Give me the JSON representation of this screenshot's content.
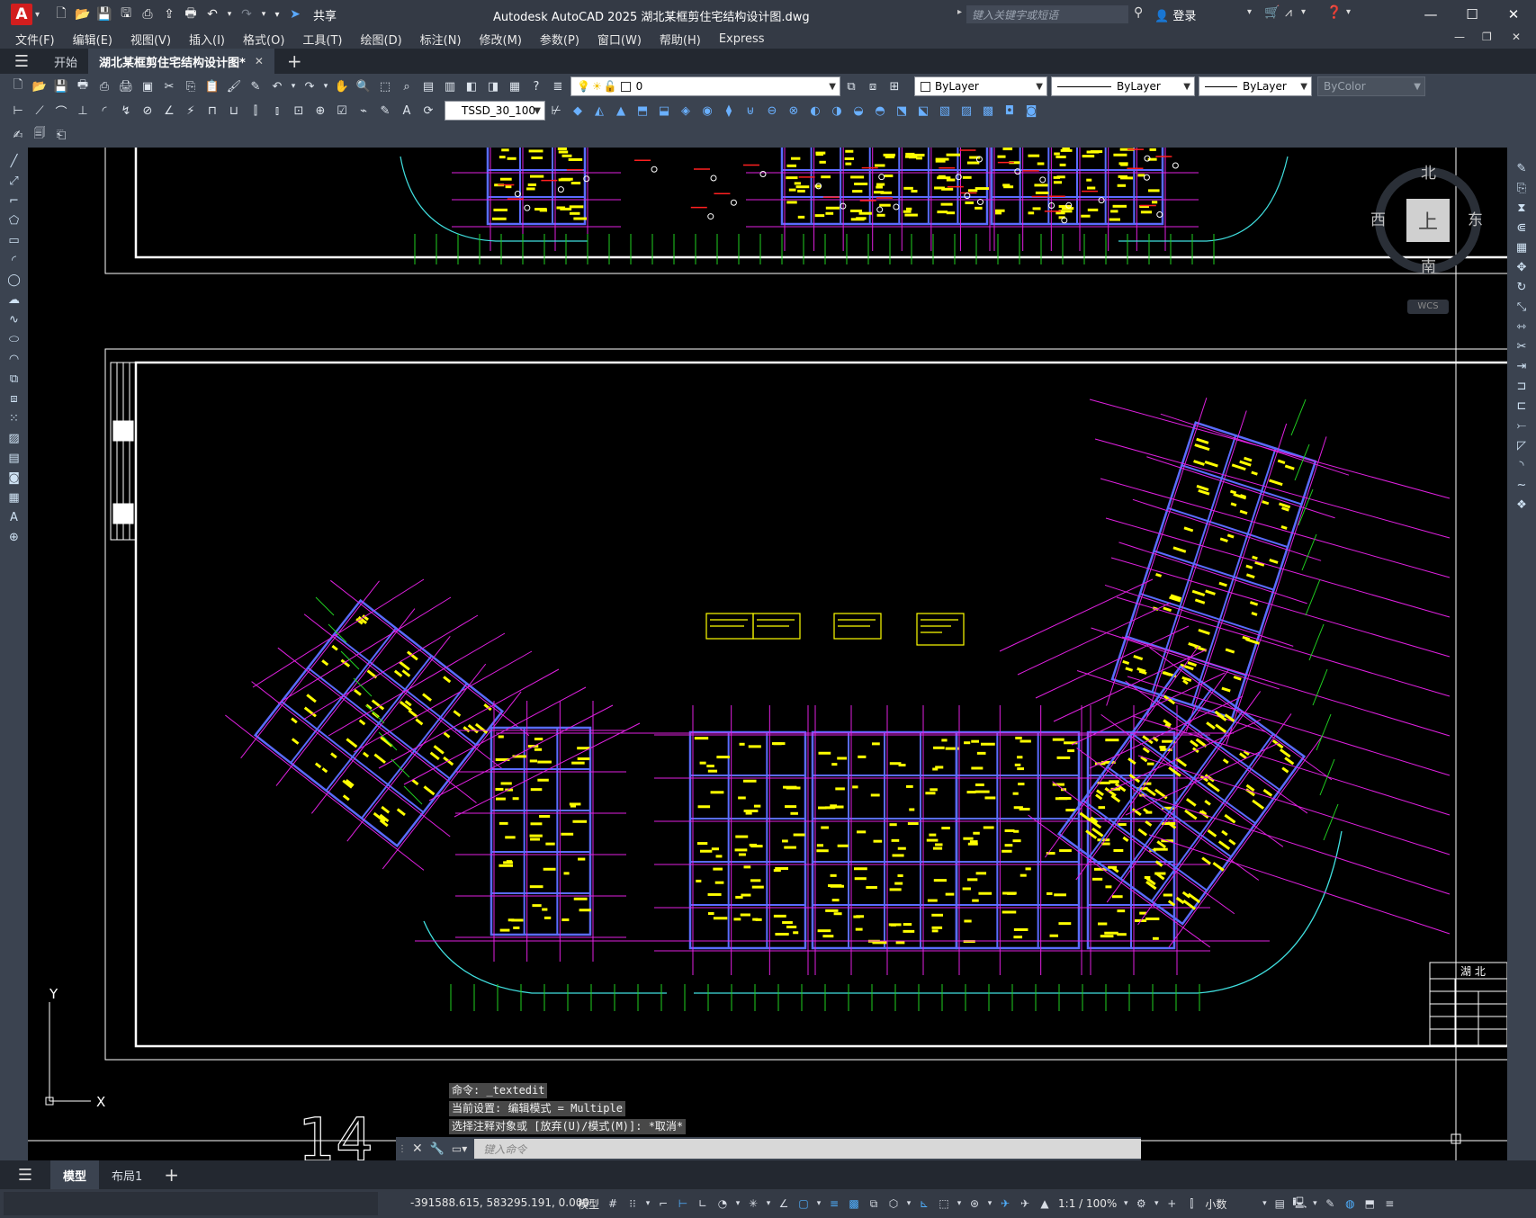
{
  "titlebar": {
    "logo": "A",
    "share_label": "共享",
    "title": "Autodesk AutoCAD 2025    湖北某框剪住宅结构设计图.dwg",
    "search_placeholder": "键入关键字或短语",
    "login_label": "登录"
  },
  "menu": [
    "文件(F)",
    "编辑(E)",
    "视图(V)",
    "插入(I)",
    "格式(O)",
    "工具(T)",
    "绘图(D)",
    "标注(N)",
    "修改(M)",
    "参数(P)",
    "窗口(W)",
    "帮助(H)",
    "Express"
  ],
  "tabs": {
    "start": "开始",
    "drawing": "湖北某框剪住宅结构设计图*"
  },
  "properties": {
    "layer_value": "0",
    "color_value": "ByLayer",
    "linetype_value": "ByLayer",
    "lineweight_value": "ByLayer",
    "plotstyle_value": "ByColor",
    "dimstyle_value": "TSSD_30_100"
  },
  "viewcube": {
    "north": "北",
    "south": "南",
    "east": "东",
    "west": "西",
    "face": "上",
    "wcs": "WCS"
  },
  "ucs": {
    "x_label": "X",
    "y_label": "Y"
  },
  "drawing_number": "14",
  "command": {
    "history": [
      "命令: _textedit",
      "当前设置: 编辑模式 = Multiple",
      "选择注释对象或 [放弃(U)/模式(M)]: *取消*"
    ],
    "input_placeholder": "键入命令"
  },
  "layout_tabs": {
    "model": "模型",
    "layout1": "布局1"
  },
  "status": {
    "coordinates": "-391588.615, 583295.191, 0.000",
    "model_label": "模型",
    "scale_label": "1:1 / 100%",
    "units_label": "小数"
  },
  "title_block": {
    "heading": "湖 北"
  },
  "colors": {
    "wall_blue": "#5a6cff",
    "axis_magenta": "#e020e0",
    "text_yellow": "#ffff00",
    "outline_cyan": "#40e0e0",
    "axis_green": "#20d020",
    "frame_white": "#ffffff",
    "beam_red": "#ff2020"
  }
}
